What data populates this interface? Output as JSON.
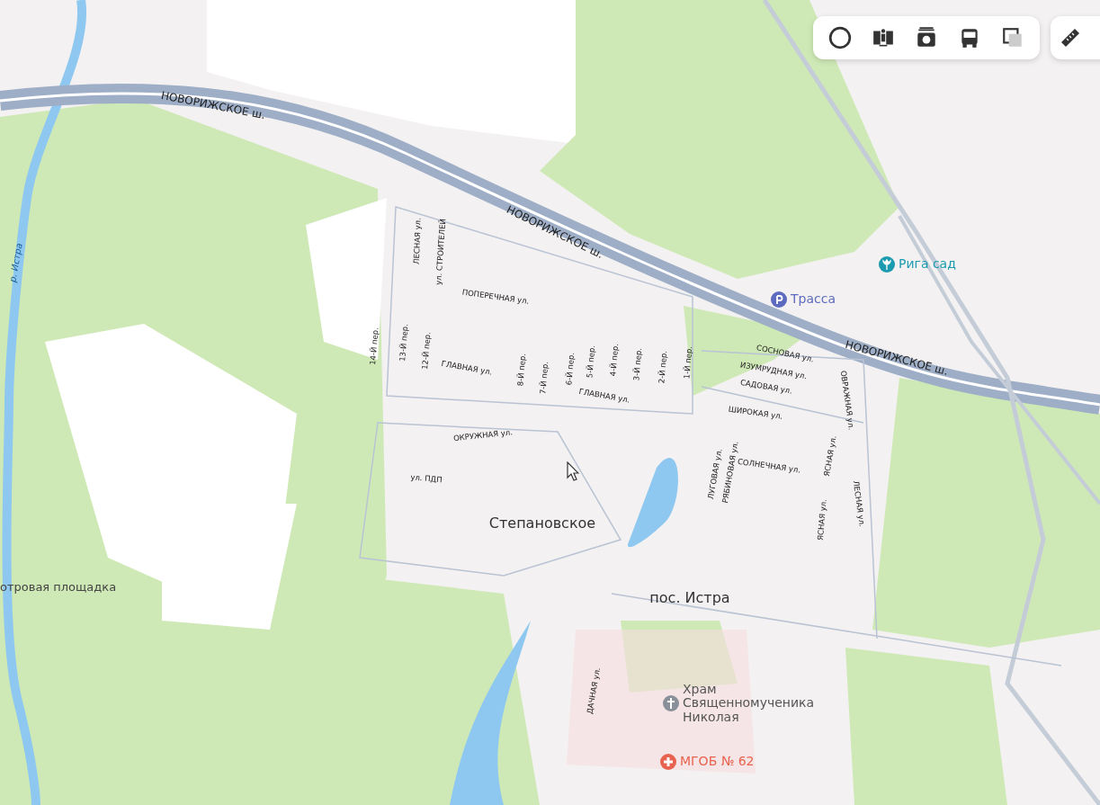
{
  "toolbar": {
    "buttons": [
      {
        "kind": "layers"
      },
      {
        "kind": "panorama"
      },
      {
        "kind": "photo"
      },
      {
        "kind": "transit"
      },
      {
        "kind": "scheme"
      }
    ],
    "ruler": {
      "kind": "ruler"
    }
  },
  "map": {
    "labels": [
      {
        "kind": "highway",
        "text": "НОВОРИЖСКОЕ ш."
      },
      {
        "kind": "highway",
        "text": "НОВОРИЖСКОЕ ш."
      },
      {
        "kind": "highway",
        "text": "НОВОРИЖСКОЕ ш."
      },
      {
        "kind": "water",
        "text": "р. Истра"
      },
      {
        "kind": "street",
        "text": "ЛЕСНАЯ ул."
      },
      {
        "kind": "street",
        "text": "ул. СТРОИТЕЛЕЙ"
      },
      {
        "kind": "street",
        "text": "ПОПЕРЕЧНАЯ ул."
      },
      {
        "kind": "street",
        "text": "14-Й пер."
      },
      {
        "kind": "street",
        "text": "13-Й пер."
      },
      {
        "kind": "street",
        "text": "12-Й пер."
      },
      {
        "kind": "street",
        "text": "ГЛАВНАЯ ул."
      },
      {
        "kind": "street",
        "text": "8-Й пер."
      },
      {
        "kind": "street",
        "text": "7-Й пер."
      },
      {
        "kind": "street",
        "text": "6-Й пер."
      },
      {
        "kind": "street",
        "text": "5-Й пер."
      },
      {
        "kind": "street",
        "text": "4-Й пер."
      },
      {
        "kind": "street",
        "text": "3-Й пер."
      },
      {
        "kind": "street",
        "text": "2-Й пер."
      },
      {
        "kind": "street",
        "text": "1-Й пер."
      },
      {
        "kind": "street",
        "text": "ГЛАВНАЯ ул."
      },
      {
        "kind": "street",
        "text": "СОСНОВАЯ ул."
      },
      {
        "kind": "street",
        "text": "ИЗУМРУДНАЯ ул."
      },
      {
        "kind": "street",
        "text": "САДОВАЯ ул."
      },
      {
        "kind": "street",
        "text": "ШИРОКАЯ ул."
      },
      {
        "kind": "street",
        "text": "ОВРАЖНАЯ ул."
      },
      {
        "kind": "street",
        "text": "ЛУГОВАЯ ул."
      },
      {
        "kind": "street",
        "text": "РЯБИНОВАЯ ул."
      },
      {
        "kind": "street",
        "text": "СОЛНЕЧНАЯ ул."
      },
      {
        "kind": "street",
        "text": "ЯСНАЯ ул."
      },
      {
        "kind": "street",
        "text": "ЯСНАЯ ул."
      },
      {
        "kind": "street",
        "text": "ЛЕСНАЯ ул."
      },
      {
        "kind": "street",
        "text": "ОКРУЖНАЯ ул."
      },
      {
        "kind": "street",
        "text": "ул. ПДП"
      },
      {
        "kind": "street",
        "text": "ДАЧНАЯ ул."
      },
      {
        "kind": "place",
        "text": "Степановское"
      },
      {
        "kind": "place",
        "text": "пос. Истра"
      },
      {
        "kind": "area",
        "text": "отровая площадка"
      }
    ],
    "pois": [
      {
        "kind": "parking",
        "text": "Трасса",
        "color": "#5c6bc0"
      },
      {
        "kind": "garden",
        "text": "Рига сад",
        "color": "#1a9bb0"
      },
      {
        "kind": "church",
        "text": "Храм\nСвященномученика\nНиколая",
        "color": "#8a9099"
      },
      {
        "kind": "hospital",
        "text": "МГОБ № 62",
        "color": "#e8634f"
      }
    ]
  }
}
